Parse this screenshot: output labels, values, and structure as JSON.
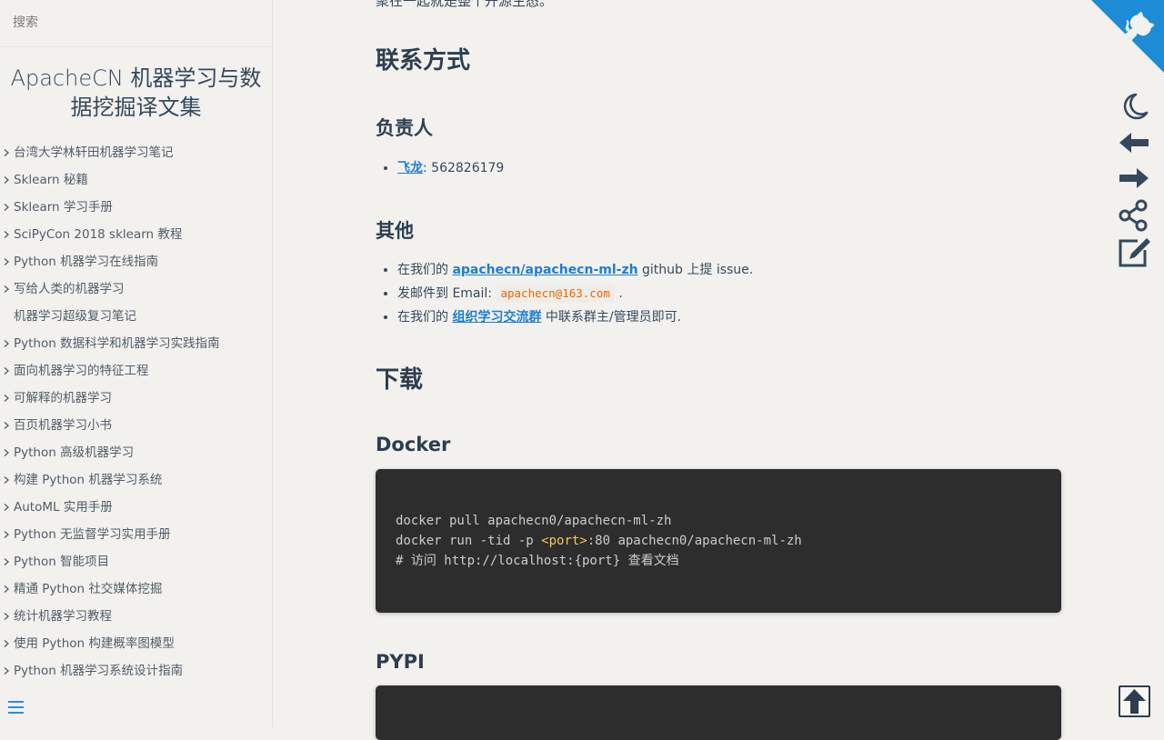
{
  "search": {
    "placeholder": "搜索"
  },
  "app_name": "ApacheCN 机器学习与数据挖掘译文集",
  "sidebar": {
    "items": [
      {
        "label": "台湾大学林轩田机器学习笔记",
        "expandable": true
      },
      {
        "label": "Sklearn 秘籍",
        "expandable": true
      },
      {
        "label": "Sklearn 学习手册",
        "expandable": true
      },
      {
        "label": "SciPyCon 2018 sklearn 教程",
        "expandable": true
      },
      {
        "label": "Python 机器学习在线指南",
        "expandable": true
      },
      {
        "label": "写给人类的机器学习",
        "expandable": true
      },
      {
        "label": "机器学习超级复习笔记",
        "expandable": false
      },
      {
        "label": "Python 数据科学和机器学习实践指南",
        "expandable": true
      },
      {
        "label": "面向机器学习的特征工程",
        "expandable": true
      },
      {
        "label": "可解释的机器学习",
        "expandable": true
      },
      {
        "label": "百页机器学习小书",
        "expandable": true
      },
      {
        "label": "Python 高级机器学习",
        "expandable": true
      },
      {
        "label": "构建 Python 机器学习系统",
        "expandable": true
      },
      {
        "label": "AutoML 实用手册",
        "expandable": true
      },
      {
        "label": "Python 无监督学习实用手册",
        "expandable": true
      },
      {
        "label": "Python 智能项目",
        "expandable": true
      },
      {
        "label": "精通 Python 社交媒体挖掘",
        "expandable": true
      },
      {
        "label": "统计机器学习教程",
        "expandable": true
      },
      {
        "label": "使用 Python 构建概率图模型",
        "expandable": true
      },
      {
        "label": "Python 机器学习系统设计指南",
        "expandable": true
      }
    ]
  },
  "content": {
    "cut_line": "聚在一起就是整个开源生态。",
    "contact_heading": "联系方式",
    "owner_heading": "负责人",
    "owner": {
      "name": "飞龙",
      "qq": ": 562826179"
    },
    "other_heading": "其他",
    "other_items": {
      "issue_prefix": "在我们的 ",
      "issue_link": "apachecn/apachecn-ml-zh",
      "issue_suffix": " github 上提 issue.",
      "email_prefix": "发邮件到 Email: ",
      "email": "apachecn@163.com",
      "email_suffix": " .",
      "group_prefix": "在我们的 ",
      "group_link": "组织学习交流群",
      "group_suffix": " 中联系群主/管理员即可."
    },
    "download_heading": "下载",
    "docker_heading": "Docker",
    "docker_code": {
      "line1": "docker pull apachecn0/apachecn-ml-zh",
      "line2_a": "docker run -tid -p ",
      "line2_tag": "<port>",
      "line2_b": ":80 apachecn0/apachecn-ml-zh",
      "line3": "# 访问 http://localhost:{port} 查看文档"
    },
    "pypi_heading": "PYPI"
  },
  "colors": {
    "background": "#f3f1ed",
    "link": "#1f7ed0",
    "heading": "#2c3e50",
    "code_bg": "#2d2d2d",
    "inline_code": "#e96900",
    "corner": "#1e8bd6"
  },
  "icons": [
    "github-corner-icon",
    "moon-icon",
    "arrow-left-icon",
    "arrow-right-icon",
    "share-icon",
    "edit-icon",
    "arrow-up-icon",
    "menu-icon",
    "chevron-right-icon"
  ]
}
